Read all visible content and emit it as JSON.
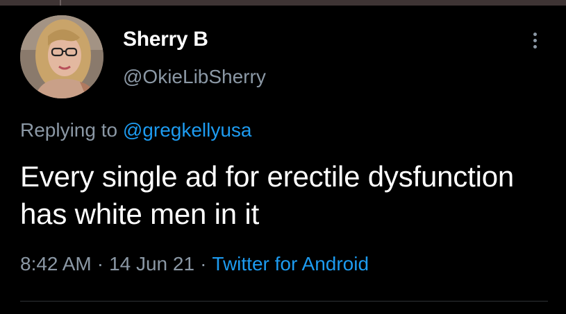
{
  "tweet": {
    "display_name": "Sherry B",
    "handle": "@OkieLibSherry",
    "replying_prefix": "Replying to",
    "replying_to": "@gregkellyusa",
    "text": "Every single ad for erectile dysfunction has white men in it",
    "time": "8:42 AM",
    "date": "14 Jun 21",
    "source": "Twitter for Android",
    "separator": "·"
  },
  "icons": {
    "more": "more-vertical-icon"
  },
  "colors": {
    "background": "#000000",
    "primary_text": "#ffffff",
    "secondary_text": "#8b98a5",
    "link": "#1d9bf0",
    "divider": "#2f3336"
  }
}
